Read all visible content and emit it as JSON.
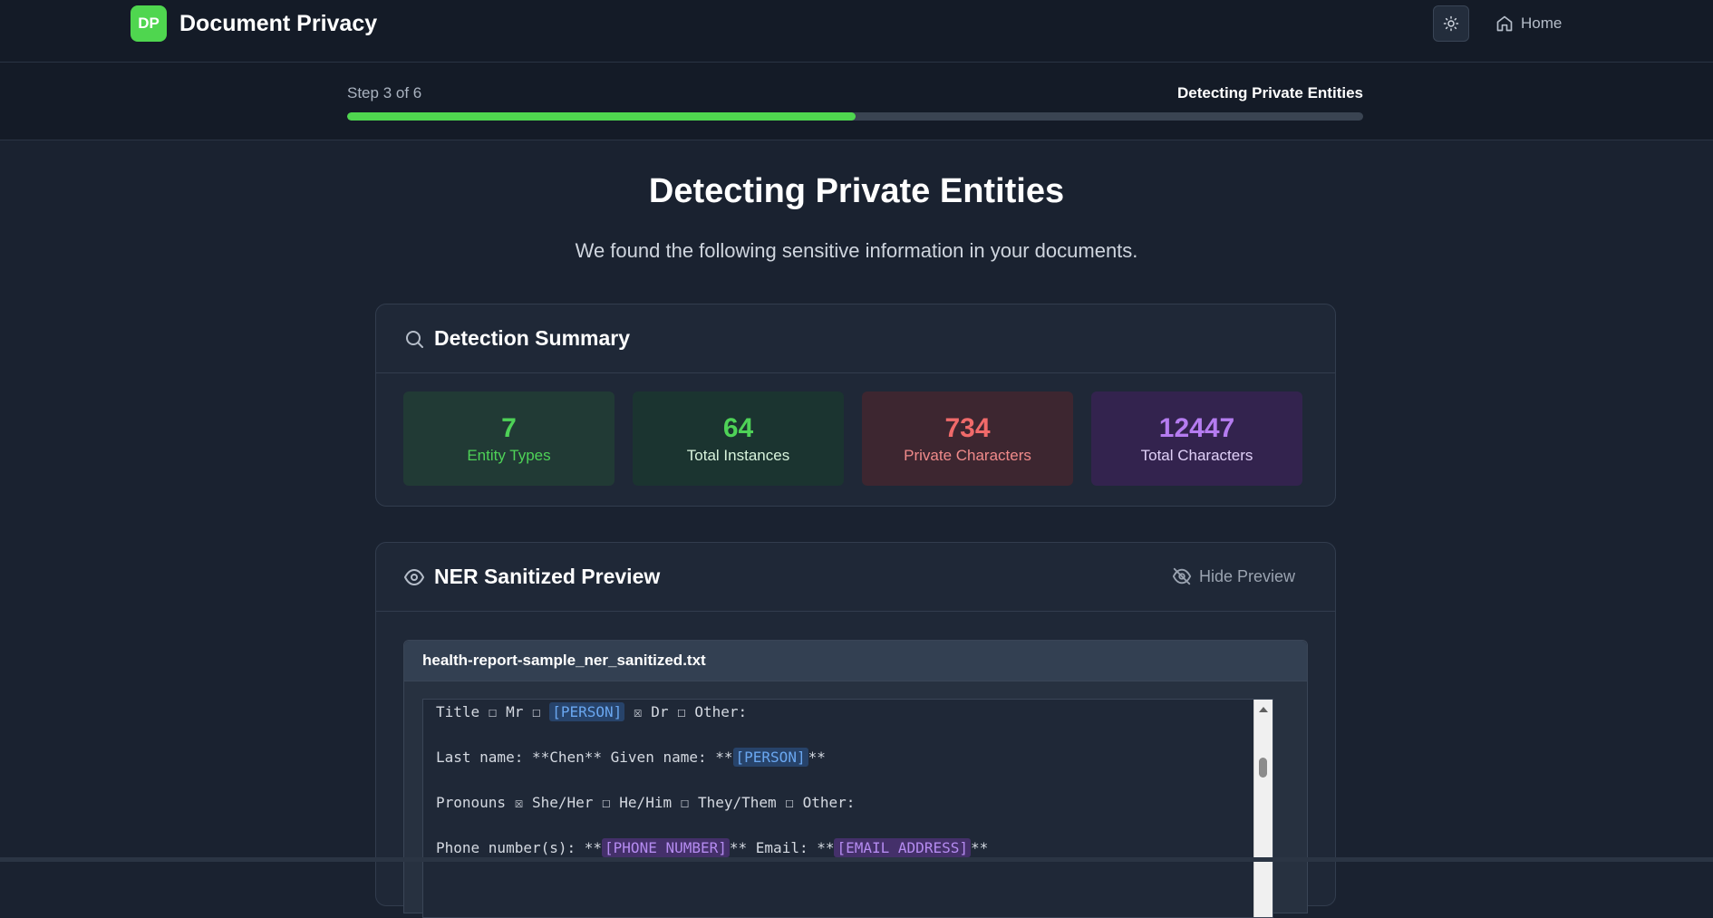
{
  "header": {
    "logo_text": "DP",
    "app_title": "Document Privacy",
    "home_label": "Home",
    "theme_icon": "sun-icon",
    "home_icon": "home-icon"
  },
  "progress": {
    "step_text": "Step 3 of 6",
    "step_title": "Detecting Private Entities",
    "fraction": 0.5
  },
  "main": {
    "title": "Detecting Private Entities",
    "subtitle": "We found the following sensitive information in your documents."
  },
  "summary": {
    "heading": "Detection Summary",
    "icon": "search-icon",
    "stats": [
      {
        "value": "7",
        "label": "Entity Types"
      },
      {
        "value": "64",
        "label": "Total Instances"
      },
      {
        "value": "734",
        "label": "Private Characters"
      },
      {
        "value": "12447",
        "label": "Total Characters"
      }
    ]
  },
  "preview": {
    "heading": "NER Sanitized Preview",
    "icon": "eye-icon",
    "hide_label": "Hide Preview",
    "hide_icon": "eye-off-icon",
    "filename": "health-report-sample_ner_sanitized.txt",
    "lines": {
      "l1_a": "Title ☐ Mr ☐ ",
      "l1_tag": "[PERSON]",
      "l1_b": " ☒ Dr ☐ Other:",
      "l2_a": "Last name: **Chen** Given name: **",
      "l2_tag": "[PERSON]",
      "l2_b": "**",
      "l3": "Pronouns ☒ She/Her ☐ He/Him ☐ They/Them ☐ Other:",
      "l4_a": "Phone number(s): **",
      "l4_tag1": "[PHONE NUMBER]",
      "l4_b": "** Email: **",
      "l4_tag2": "[EMAIL ADDRESS]",
      "l4_c": "**"
    }
  },
  "colors": {
    "accent": "#4fd64f",
    "background": "#1a2230",
    "person_tag": "#6aa7f0",
    "contact_tag": "#b58bf0"
  }
}
